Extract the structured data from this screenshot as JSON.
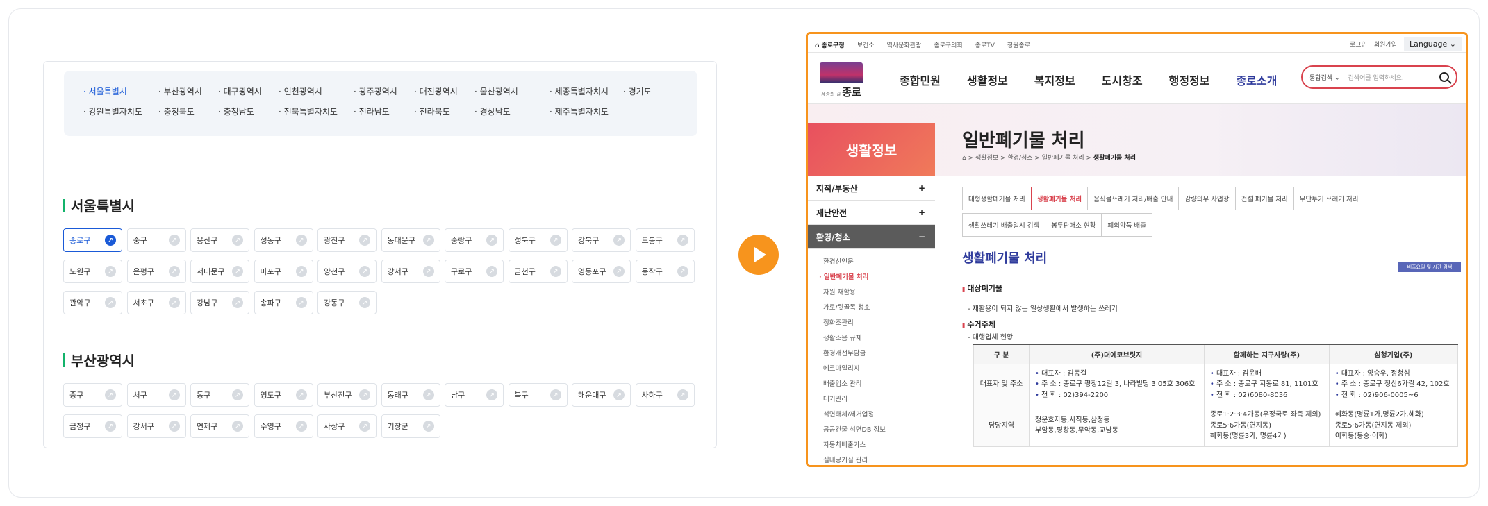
{
  "regions": [
    "서울특별시",
    "부산광역시",
    "대구광역시",
    "인천광역시",
    "광주광역시",
    "대전광역시",
    "울산광역시",
    "세종특별자치시",
    "경기도",
    "강원특별자치도",
    "충청북도",
    "충청남도",
    "전북특별자치도",
    "전라남도",
    "전라북도",
    "경상남도",
    "제주특별자치도"
  ],
  "seoul": {
    "title": "서울특별시",
    "districts": [
      "종로구",
      "중구",
      "용산구",
      "성동구",
      "광진구",
      "동대문구",
      "중랑구",
      "성북구",
      "강북구",
      "도봉구",
      "노원구",
      "은평구",
      "서대문구",
      "마포구",
      "양천구",
      "강서구",
      "구로구",
      "금천구",
      "영등포구",
      "동작구",
      "관악구",
      "서초구",
      "강남구",
      "송파구",
      "강동구"
    ]
  },
  "busan": {
    "title": "부산광역시",
    "districts": [
      "중구",
      "서구",
      "동구",
      "영도구",
      "부산진구",
      "동래구",
      "남구",
      "북구",
      "해운대구",
      "사하구",
      "금정구",
      "강서구",
      "연제구",
      "수영구",
      "사상구",
      "기장군"
    ]
  },
  "preview": {
    "topbar_left": [
      "종로구청",
      "보건소",
      "역사문화관광",
      "종로구의회",
      "종로TV",
      "청원종로"
    ],
    "login": "로그인",
    "join": "회원가입",
    "language": "Language",
    "logo_small": "세종의 길",
    "logo_text": "종로",
    "gnb": [
      "종합민원",
      "생활정보",
      "복지정보",
      "도시창조",
      "행정정보",
      "종로소개"
    ],
    "search_select": "통합검색",
    "search_placeholder": "검색어를 입력하세요.",
    "side_title": "생활정보",
    "page_title": "일반폐기물 처리",
    "breadcrumb": "⌂ > 생활정보 > 환경/청소 > 일반폐기물 처리 >",
    "breadcrumb_current": "생활폐기물 처리",
    "side_menu": [
      {
        "label": "지적/부동산",
        "sign": "+"
      },
      {
        "label": "재난안전",
        "sign": "+"
      },
      {
        "label": "환경/청소",
        "sign": "−"
      }
    ],
    "side_sub": [
      "· 환경선언문",
      "· 일반폐기물 처리",
      "· 자원 재활용",
      "· 가로/뒷골목 청소",
      "· 정화조관리",
      "· 생활소음 규제",
      "· 환경개선부담금",
      "· 에코마일리지",
      "· 배출업소 관리",
      "· 대기관리",
      "· 석면해체/제거업정",
      "· 공공건물 석면DB 정보",
      "· 자동차배출가스",
      "· 실내공기질 관리"
    ],
    "tabs_row1": [
      "대형생활폐기물 처리",
      "생활폐기물 처리",
      "음식물쓰레기 처리/배출 안내",
      "감량의무 사업장",
      "건설 폐기물 처리",
      "무단투기 쓰레기 처리"
    ],
    "tabs_row2": [
      "생활쓰레기 배출일시 검색",
      "봉투판매소 현황",
      "폐의약품 배출"
    ],
    "content_title": "생활폐기물 처리",
    "schedule_btn": "배출요일 및 시간 검색",
    "target_heading": "대상폐기물",
    "target_text": "- 재활용이 되지 않는 일상생활에서 발생하는 쓰레기",
    "agent_heading": "수거주체",
    "agent_sub": "- 대행업체 현황",
    "table": {
      "headers": [
        "구 분",
        "(주)더에코브릿지",
        "함께하는 지구사랑(주)",
        "심청기업(주)"
      ],
      "row1_label": "대표자 및 주소",
      "row1": [
        [
          "대표자 : 김동걸",
          "주 소 : 종로구 평창12길 3, 나라빌딩 3 05호 306호",
          "전 화 : 02)394-2200"
        ],
        [
          "대표자 : 김윤배",
          "주 소 : 종로구 지봉로 81, 1101호",
          "전 화 : 02)6080-8036"
        ],
        [
          "대표자 : 양승우, 정청심",
          "주 소 : 종로구 청산6가길 42, 102호",
          "전 화 : 02)906-0005~6"
        ]
      ],
      "row2_label": "담당지역",
      "row2": [
        [
          "청운효자동,사직동,삼청동",
          "부암동,평창동,무악동,교남동"
        ],
        [
          "종로1·2·3·4가동(우정국로 좌측 제외)",
          "종로5·6가동(연지동)",
          "혜화동(명륜3가, 명륜4가)"
        ],
        [
          "혜화동(명륜1가,명륜2가,혜화)",
          "종로5·6가동(연지동 제외)",
          "이화동(동숭·이화)"
        ]
      ]
    }
  }
}
